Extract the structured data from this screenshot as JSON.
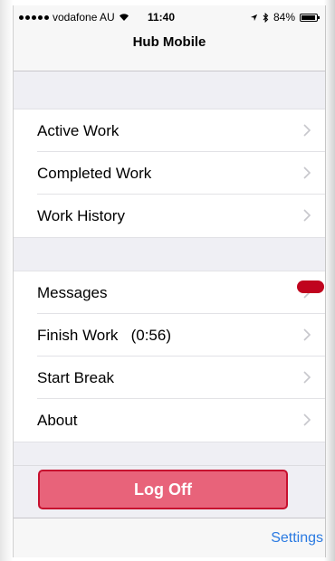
{
  "status_bar": {
    "carrier": "vodafone AU",
    "time": "11:40",
    "battery": "84%",
    "battery_level": 0.84,
    "icons": [
      "signal-dots-icon",
      "wifi-icon",
      "location-arrow-icon",
      "bluetooth-icon",
      "battery-icon"
    ]
  },
  "nav": {
    "title": "Hub Mobile"
  },
  "groups": [
    {
      "items": [
        "Active Work",
        "Completed Work",
        "Work History"
      ]
    },
    {
      "items": [
        "Messages",
        "Finish Work   (0:56)",
        "Start Break",
        "About"
      ]
    }
  ],
  "logoff_label": "Log Off",
  "toolbar": {
    "settings_label": "Settings"
  },
  "colors": {
    "background": "#efeff4",
    "logoff_fill": "#e8637a",
    "logoff_border": "#c7102f",
    "link": "#2a7ae2",
    "marker": "#c0041e"
  }
}
